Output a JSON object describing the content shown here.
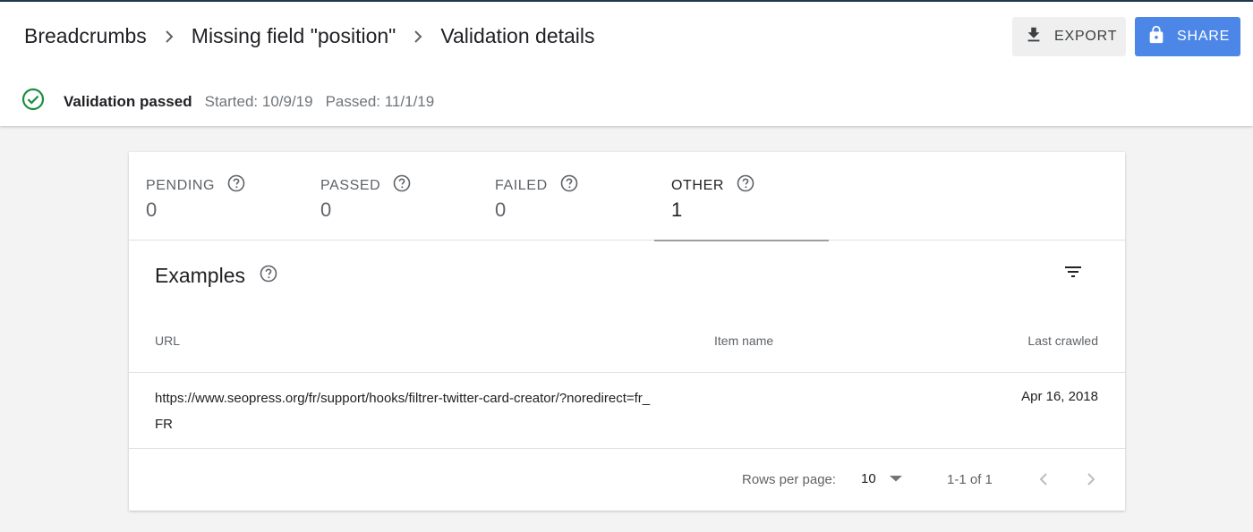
{
  "breadcrumb": {
    "items": [
      "Breadcrumbs",
      "Missing field \"position\""
    ],
    "current": "Validation details"
  },
  "actions": {
    "export_label": "EXPORT",
    "share_label": "SHARE"
  },
  "status": {
    "icon": "check-circle-icon",
    "label": "Validation passed",
    "started": "Started: 10/9/19",
    "passed": "Passed: 11/1/19",
    "color": "#1e8e3e"
  },
  "tabs": [
    {
      "label": "PENDING",
      "value": "0",
      "active": false
    },
    {
      "label": "PASSED",
      "value": "0",
      "active": false
    },
    {
      "label": "FAILED",
      "value": "0",
      "active": false
    },
    {
      "label": "OTHER",
      "value": "1",
      "active": true
    }
  ],
  "examples": {
    "title": "Examples",
    "columns": [
      "URL",
      "Item name",
      "Last crawled"
    ],
    "rows": [
      {
        "url": "https://www.seopress.org/fr/support/hooks/filtrer-twitter-card-creator/?noredirect=fr_FR",
        "item_name": "",
        "last_crawled": "Apr 16, 2018"
      }
    ]
  },
  "pagination": {
    "rows_per_page_label": "Rows per page:",
    "rows_per_page": "10",
    "range": "1-1 of 1"
  },
  "colors": {
    "accent": "#4c87e8",
    "header_border": "#1e3a4a"
  }
}
